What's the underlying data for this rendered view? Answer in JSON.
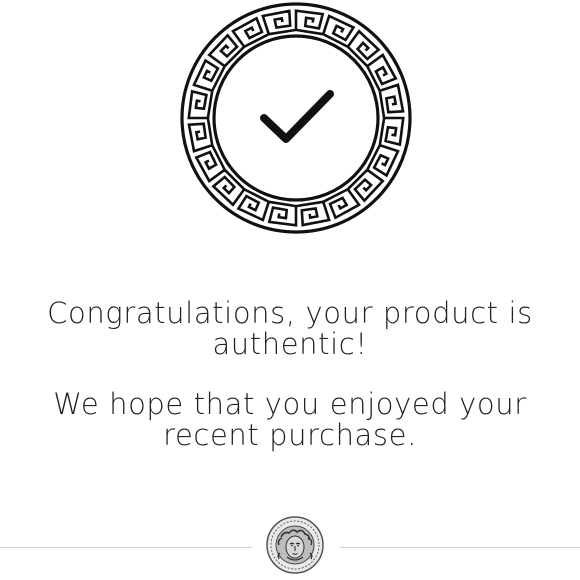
{
  "seal": {
    "icon": "greek-key-seal-check-icon",
    "stroke_color": "#111111"
  },
  "messages": {
    "line1": "Congratulations, your product is",
    "line2": "authentic!",
    "line3": "We hope that you enjoyed your",
    "line4": "recent purchase."
  },
  "footer": {
    "logo_icon": "medusa-logo-icon",
    "divider_color": "#cfcfcf"
  }
}
